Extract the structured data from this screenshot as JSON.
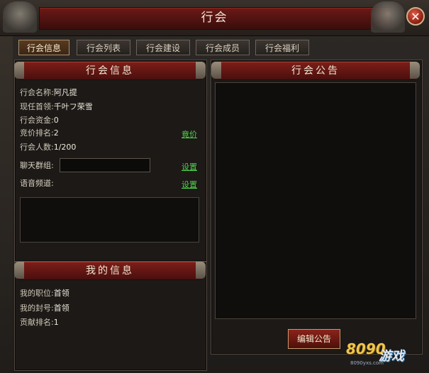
{
  "window": {
    "title": "行会",
    "close_symbol": "✕"
  },
  "tabs": [
    "行会信息",
    "行会列表",
    "行会建设",
    "行会成员",
    "行会福利"
  ],
  "guild_info": {
    "header": "行会信息",
    "name_label": "行会名称:",
    "name_value": "阿凡提",
    "leader_label": "现任首领:",
    "leader_value": "千叶フ荣雪",
    "funds_label": "行会资金:",
    "funds_value": "0",
    "rank_label": "竞价排名:",
    "rank_value": "2",
    "bid_link": "竟价",
    "members_label": "行会人数:",
    "members_value": "1/200",
    "chat_label": "聊天群组:",
    "chat_value": "",
    "chat_set_link": "设置",
    "voice_label": "语音频道:",
    "voice_set_link": "设置"
  },
  "my_info": {
    "header": "我的信息",
    "position_label": "我的职位:",
    "position_value": "首领",
    "title_label": "我的封号:",
    "title_value": "首领",
    "contrib_label": "贡献排名:",
    "contrib_value": "1"
  },
  "notice": {
    "header": "行会公告",
    "edit_button": "编辑公告"
  },
  "watermark": {
    "number": "8090",
    "text": "游戏",
    "url": "8090yxs.com"
  },
  "colors": {
    "accent_red": "#7b1e18",
    "link_green": "#4fd04a",
    "tab_active": "#5a3a22"
  }
}
